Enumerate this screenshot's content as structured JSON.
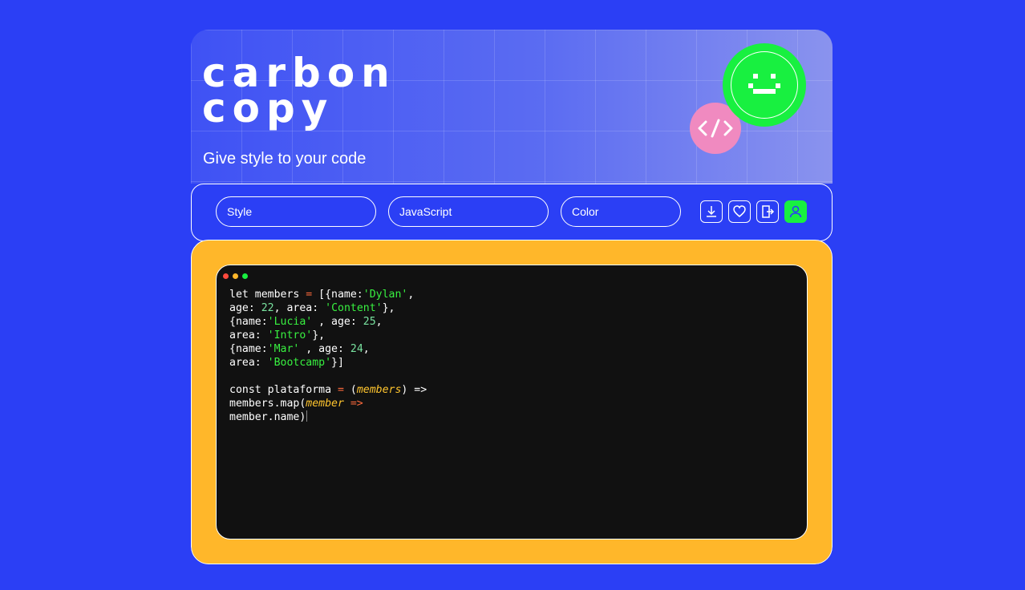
{
  "header": {
    "logo_line1": "carbon",
    "logo_line2": "copy",
    "tagline": "Give style to your code"
  },
  "toolbar": {
    "style_select": "Style",
    "language_select": "JavaScript",
    "color_select": "Color",
    "icons": [
      "download-icon",
      "heart-icon",
      "logout-icon",
      "user-icon"
    ]
  },
  "editor": {
    "code": {
      "l1_a": "let members ",
      "l1_b": "=",
      "l1_c": " [{name:",
      "l1_d": "'Dylan'",
      "l1_e": ",",
      "l2_a": "age: ",
      "l2_b": "22",
      "l2_c": ", area: ",
      "l2_d": "'Content'",
      "l2_e": "},",
      "l3_a": "{name:",
      "l3_b": "'Lucia'",
      "l3_c": " , age: ",
      "l3_d": "25",
      "l3_e": ",",
      "l4_a": "area: ",
      "l4_b": "'Intro'",
      "l4_c": "},",
      "l5_a": "{name:",
      "l5_b": "'Mar'",
      "l5_c": " , age: ",
      "l5_d": "24",
      "l5_e": ",",
      "l6_a": "area: ",
      "l6_b": "'Bootcamp'",
      "l6_c": "}]",
      "l8_a": "const plataforma ",
      "l8_b": "=",
      "l8_c": " (",
      "l8_d": "members",
      "l8_e": ") =>",
      "l9_a": "members.map(",
      "l9_b": "member",
      "l9_c": " =>",
      "l10_a": "member.name)"
    }
  },
  "colors": {
    "background": "#2b3ff5",
    "stage": "#ffb72a",
    "editor_bg": "#111111",
    "accent_green": "#18f040",
    "badge_pink": "#f08ac0"
  }
}
